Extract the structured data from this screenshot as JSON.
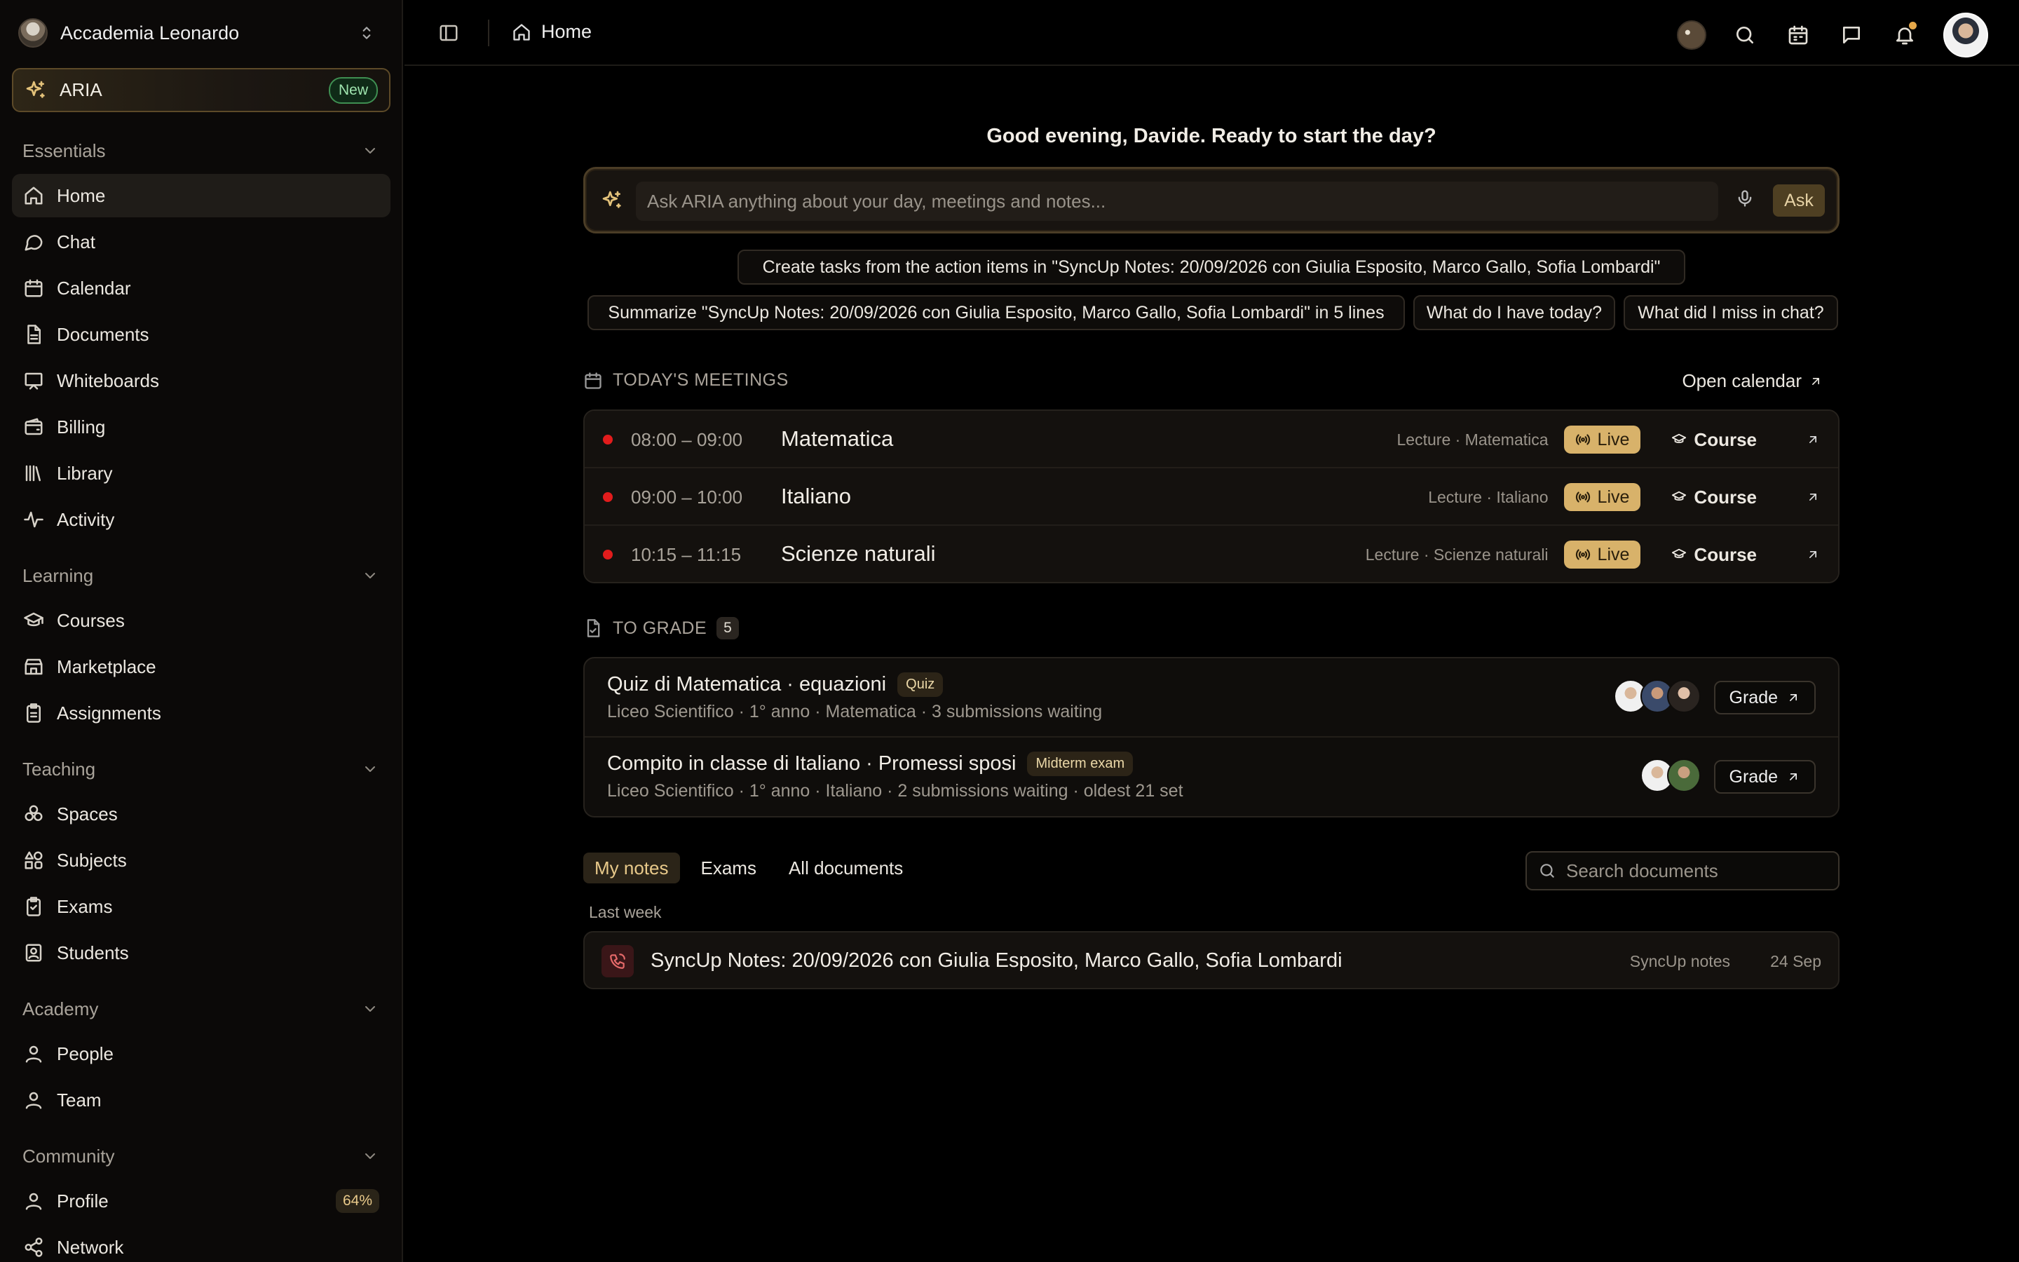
{
  "workspace": {
    "name": "Accademia Leonardo"
  },
  "aria": {
    "label": "ARIA",
    "badge": "New"
  },
  "sidebar": {
    "sections": [
      {
        "title": "Essentials",
        "items": [
          "Home",
          "Chat",
          "Calendar",
          "Documents",
          "Whiteboards",
          "Billing",
          "Library",
          "Activity"
        ]
      },
      {
        "title": "Learning",
        "items": [
          "Courses",
          "Marketplace",
          "Assignments"
        ]
      },
      {
        "title": "Teaching",
        "items": [
          "Spaces",
          "Subjects",
          "Exams",
          "Students"
        ]
      },
      {
        "title": "Academy",
        "items": [
          "People",
          "Team"
        ]
      },
      {
        "title": "Community",
        "items": [
          "Profile",
          "Network"
        ]
      }
    ],
    "active_item": "Home",
    "profile_completion": "64%"
  },
  "topbar": {
    "breadcrumb": "Home"
  },
  "greeting": "Good evening, Davide. Ready to start the day?",
  "ask": {
    "placeholder": "Ask ARIA anything about your day, meetings and notes...",
    "button": "Ask"
  },
  "suggestions": [
    "Create tasks from the action items in \"SyncUp Notes: 20/09/2026 con Giulia Esposito, Marco Gallo, Sofia Lombardi\"",
    "Summarize \"SyncUp Notes: 20/09/2026 con Giulia Esposito, Marco Gallo, Sofia Lombardi\" in 5 lines",
    "What do I have today?",
    "What did I miss in chat?"
  ],
  "meetings": {
    "heading": "TODAY'S MEETINGS",
    "open_calendar": "Open calendar",
    "items": [
      {
        "time": "08:00 – 09:00",
        "title": "Matematica",
        "meta": "Lecture · Matematica",
        "status": "Live",
        "link": "Course"
      },
      {
        "time": "09:00 – 10:00",
        "title": "Italiano",
        "meta": "Lecture · Italiano",
        "status": "Live",
        "link": "Course"
      },
      {
        "time": "10:15 – 11:15",
        "title": "Scienze naturali",
        "meta": "Lecture · Scienze naturali",
        "status": "Live",
        "link": "Course"
      }
    ]
  },
  "to_grade": {
    "heading": "TO GRADE",
    "count": "5",
    "items": [
      {
        "title": "Quiz di Matematica · equazioni",
        "tag": "Quiz",
        "subtitle": "Liceo Scientifico · 1° anno · Matematica · 3 submissions waiting",
        "button": "Grade",
        "avatars": 3
      },
      {
        "title": "Compito in classe di Italiano · Promessi sposi",
        "tag": "Midterm exam",
        "subtitle": "Liceo Scientifico · 1° anno · Italiano · 2 submissions waiting · oldest 21 set",
        "button": "Grade",
        "avatars": 2
      }
    ]
  },
  "docs": {
    "tabs": [
      "My notes",
      "Exams",
      "All documents"
    ],
    "active_tab": "My notes",
    "search_placeholder": "Search documents",
    "group": "Last week",
    "items": [
      {
        "title": "SyncUp Notes: 20/09/2026 con Giulia Esposito, Marco Gallo, Sofia Lombardi",
        "type": "SyncUp notes",
        "date": "24 Sep"
      }
    ]
  },
  "colors": {
    "accent": "#d8b26a",
    "live_dot": "#e21c1c",
    "new_badge": "#3f8f52",
    "background": "#000000"
  }
}
